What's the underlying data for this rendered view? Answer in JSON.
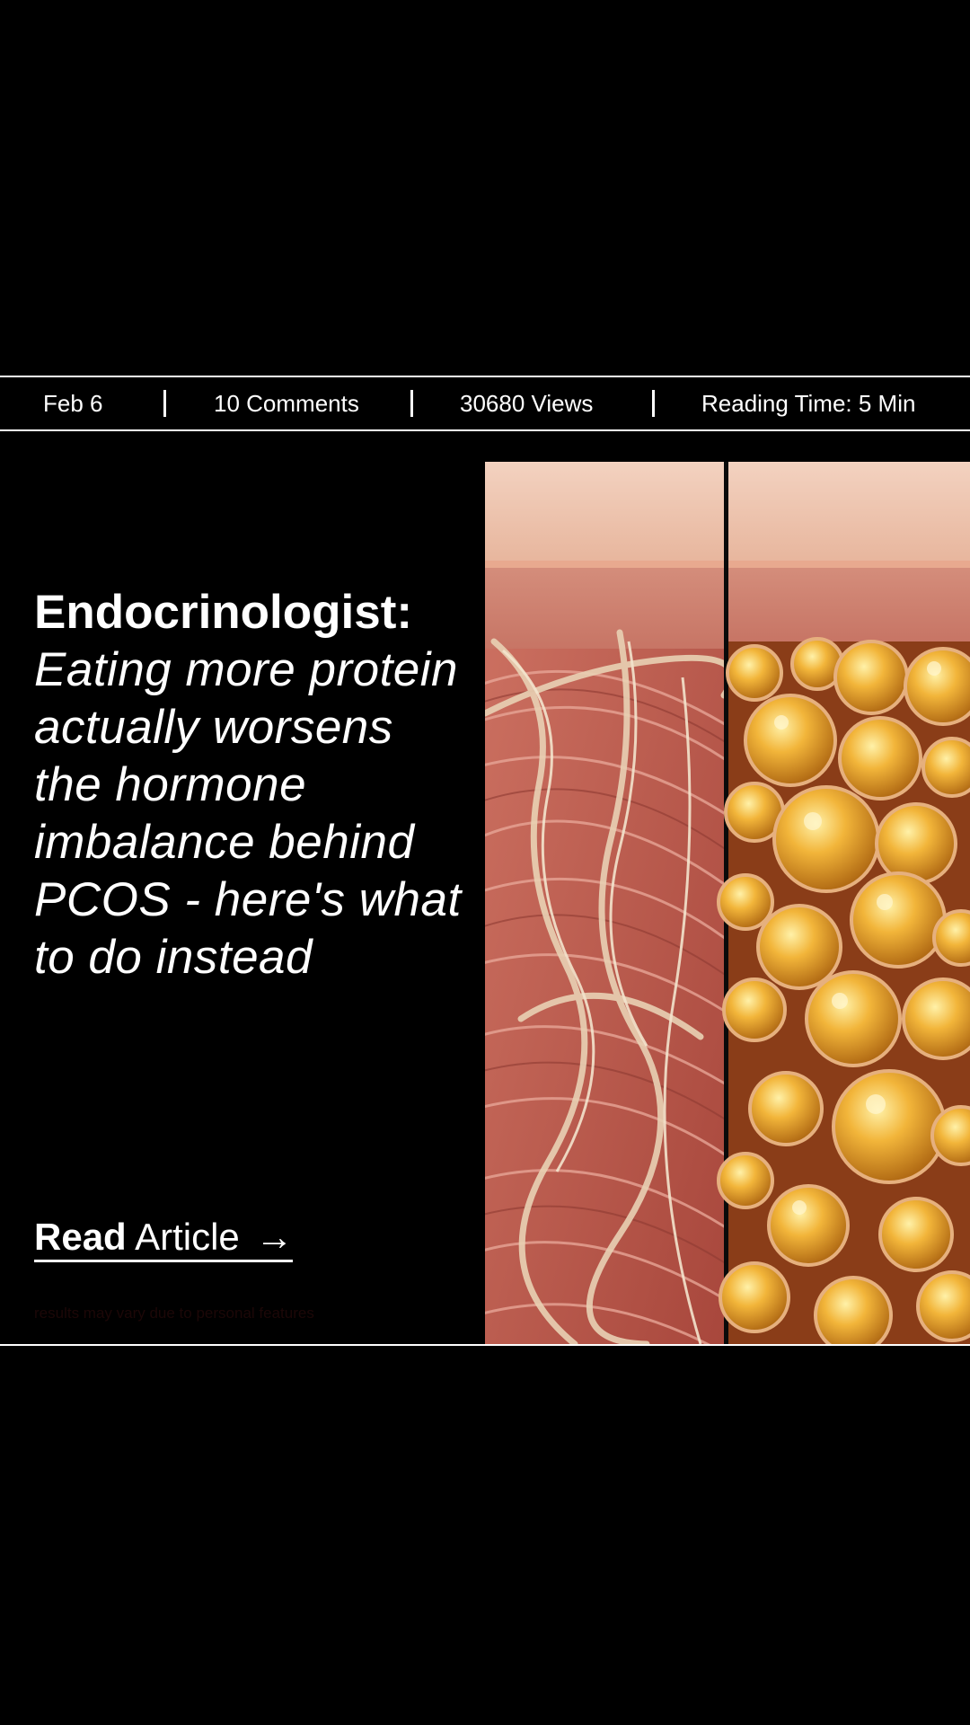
{
  "meta": {
    "date": "Feb 6",
    "comments": "10 Comments",
    "views": "30680 Views",
    "reading_time": "Reading Time: 5 Min"
  },
  "headline": {
    "strong": "Endocrinologist:",
    "body": "Eating more protein actually worsens the hormone imbalance behind PCOS - here's what to do instead"
  },
  "cta": {
    "strong": "Read",
    "rest": "Article",
    "arrow": "→"
  },
  "disclaimer": "results may vary due to personal features",
  "illustration": {
    "left_panel": "muscle-tissue-illustration",
    "right_panel": "fat-tissue-illustration"
  },
  "colors": {
    "background": "#000000",
    "text": "#ffffff",
    "skin": "#e8b9a0",
    "muscle": "#c86a5c",
    "fat": "#e6a52a"
  }
}
